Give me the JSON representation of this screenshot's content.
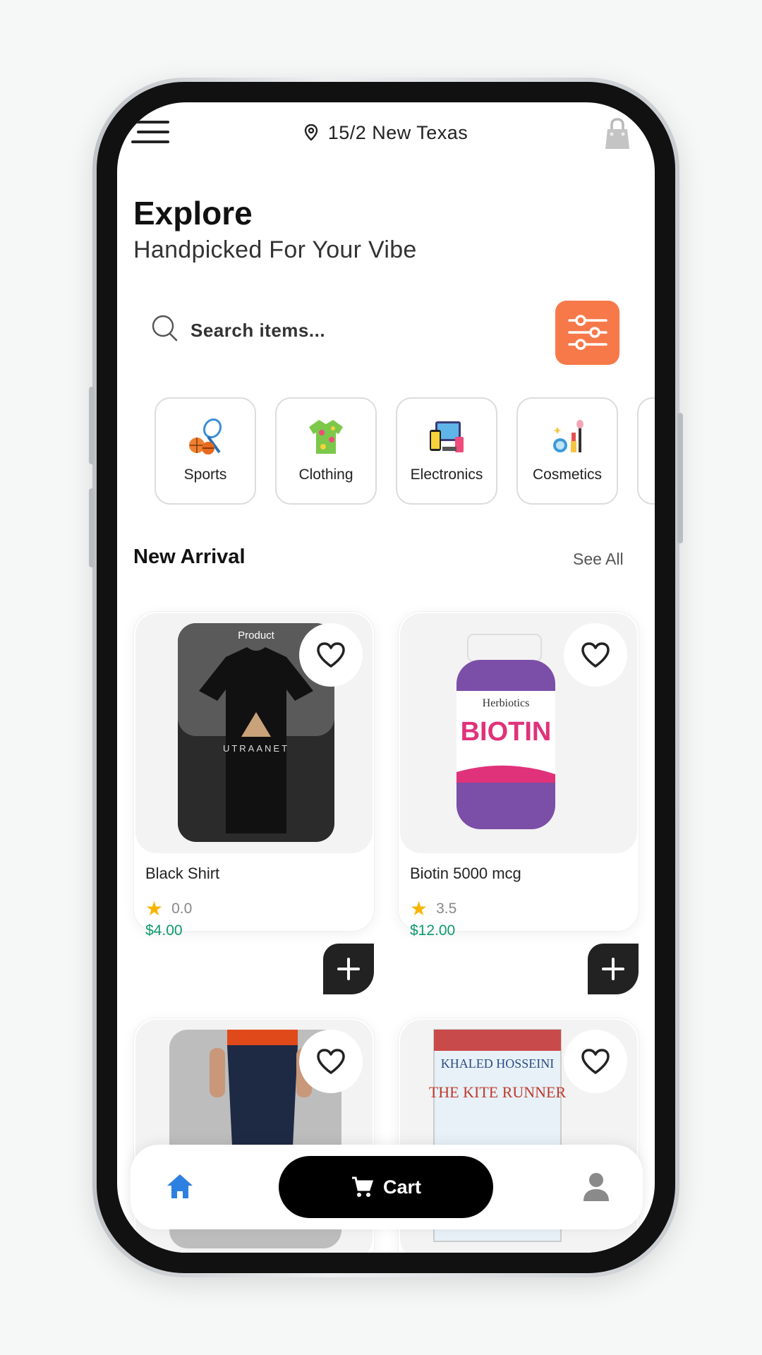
{
  "header": {
    "location": "15/2 New Texas"
  },
  "hero": {
    "title": "Explore",
    "subtitle": "Handpicked For Your Vibe"
  },
  "search": {
    "placeholder": "Search items..."
  },
  "categories": [
    {
      "label": "Sports",
      "icon": "sports-icon"
    },
    {
      "label": "Clothing",
      "icon": "clothing-icon"
    },
    {
      "label": "Electronics",
      "icon": "electronics-icon"
    },
    {
      "label": "Cosmetics",
      "icon": "cosmetics-icon"
    }
  ],
  "new_arrival": {
    "title": "New Arrival",
    "see_all": "See All"
  },
  "products": [
    {
      "name": "Black Shirt",
      "rating": "0.0",
      "price": "$4.00",
      "image_caption": "Product",
      "brand_text": "UTRAANET"
    },
    {
      "name": "Biotin 5000 mcg",
      "rating": "3.5",
      "price": "$12.00",
      "brand_text": "Herbiotics",
      "product_text": "BIOTIN"
    },
    {
      "name": "",
      "rating": "",
      "price": ""
    },
    {
      "name": "",
      "rating": "",
      "price": "",
      "book_author": "KHALED HOSSEINI",
      "book_title": "THE KITE RUNNER"
    }
  ],
  "bottom_nav": {
    "cart_label": "Cart"
  },
  "colors": {
    "accent": "#f7794a",
    "price": "#0c9a6b",
    "home_active": "#2d7fe0",
    "star": "#f7b500"
  }
}
